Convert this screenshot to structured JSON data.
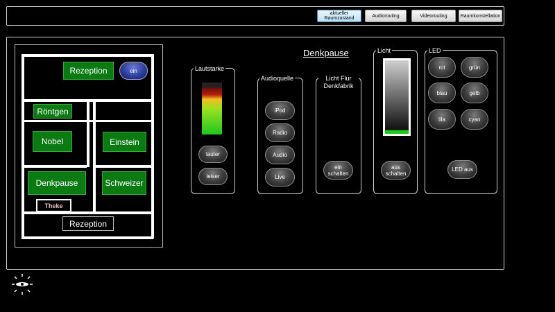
{
  "top_tabs": [
    {
      "label": "aktueller Raumzustand",
      "active": true
    },
    {
      "label": "Audiorouting",
      "active": false
    },
    {
      "label": "Videorouting",
      "active": false
    },
    {
      "label": "Raumkonstellation",
      "active": false
    }
  ],
  "floorplan": {
    "rooms": {
      "rezeption_top": "Rezeption",
      "roentgen": "Röntgen",
      "nobel": "Nobel",
      "einstein": "Einstein",
      "denkpause": "Denkpause",
      "schweizer": "Schweizer",
      "theke": "Theke",
      "rezeption_bottom": "Rezeption"
    },
    "rezeption_toggle": "ein"
  },
  "room_title": "Denkpause",
  "volume": {
    "label": "Lautstarke",
    "level": 0.9,
    "louder": "lauter",
    "quieter": "leiser"
  },
  "audio_source": {
    "label": "Audioquelle",
    "options": [
      "iPod",
      "Radio",
      "Audio",
      "Live"
    ]
  },
  "corridor_light": {
    "label": "Licht Flur Denkfabrik",
    "button": "ein schalten"
  },
  "light": {
    "label": "Licht",
    "level": 0.05,
    "button": "aus schalten"
  },
  "led": {
    "label": "LED",
    "colors": [
      "rot",
      "grün",
      "blau",
      "gelb",
      "lila",
      "cyan"
    ],
    "off": "LED aus"
  },
  "colors": {
    "room_green": "#0b7a12",
    "active_toggle": "#2a3a9a",
    "meter_green": "#1ec81e",
    "meter_red": "#8b1a0a"
  },
  "icons": {
    "logo": "clock-sun-icon"
  }
}
